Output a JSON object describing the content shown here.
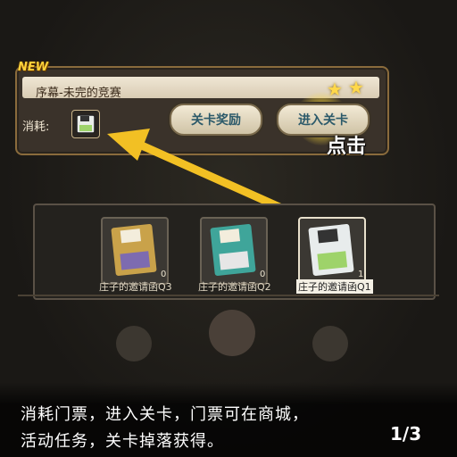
{
  "stage": {
    "new_tag": "NEW",
    "title": "序幕-未完的竞赛",
    "cost_label": "消耗:",
    "stars": [
      "★",
      "★"
    ],
    "reward_button": "关卡奖励",
    "enter_button": "进入关卡"
  },
  "tutorial": {
    "tap_label": "点击",
    "caption_line1": "消耗门票，进入关卡，门票可在商城，",
    "caption_line2": "活动任务，关卡掉落获得。",
    "page_indicator": "1/3"
  },
  "tickets": [
    {
      "name": "庄子的邀请函Q3",
      "count": "0",
      "color": "#c9a24a"
    },
    {
      "name": "庄子的邀请函Q2",
      "count": "0",
      "color": "#3fa59a"
    },
    {
      "name": "庄子的邀请函Q1",
      "count": "1",
      "color": "#e8ecec",
      "selected": true
    }
  ],
  "colors": {
    "arrow": "#f2c024",
    "highlight": "#ffe44a",
    "panel_border": "#8a6b3c"
  }
}
